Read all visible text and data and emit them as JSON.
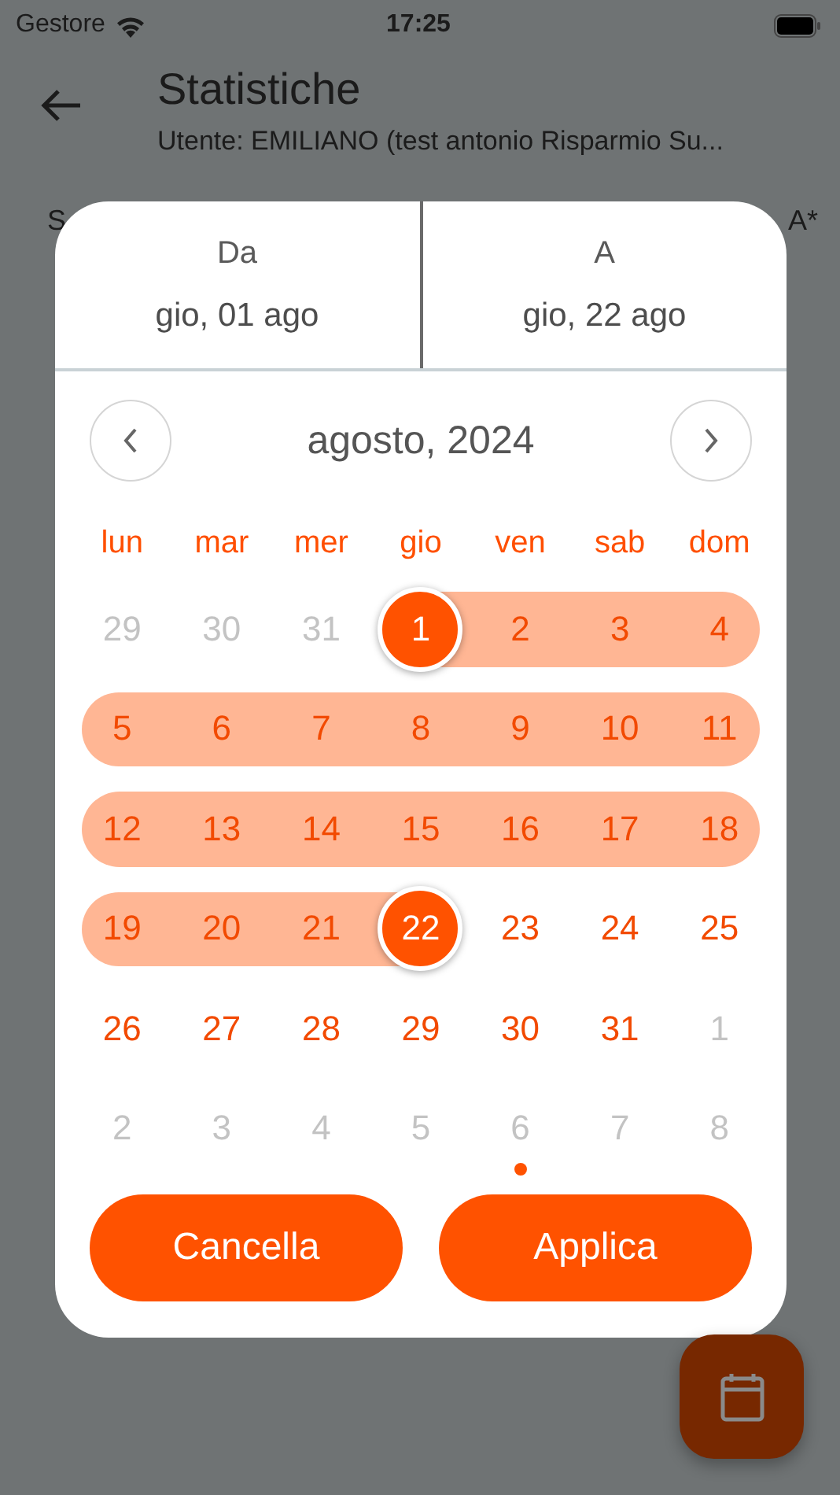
{
  "status_bar": {
    "carrier": "Gestore",
    "time": "17:25"
  },
  "header": {
    "title": "Statistiche",
    "subtitle": "Utente: EMILIANO (test antonio Risparmio Su..."
  },
  "background_row": {
    "left_text": "S",
    "right_text": "A*"
  },
  "date_picker": {
    "range": [
      {
        "label": "Da",
        "value": "gio, 01 ago"
      },
      {
        "label": "A",
        "value": "gio, 22 ago"
      }
    ],
    "month": "agosto, 2024",
    "weekdays": [
      "lun",
      "mar",
      "mer",
      "gio",
      "ven",
      "sab",
      "dom"
    ],
    "days": [
      {
        "label": "29",
        "outside": true,
        "in_range": false,
        "selected": false,
        "marked": false
      },
      {
        "label": "30",
        "outside": true,
        "in_range": false,
        "selected": false,
        "marked": false
      },
      {
        "label": "31",
        "outside": true,
        "in_range": false,
        "selected": false,
        "marked": false
      },
      {
        "label": "1",
        "outside": false,
        "in_range": true,
        "selected": true,
        "marked": false
      },
      {
        "label": "2",
        "outside": false,
        "in_range": true,
        "selected": false,
        "marked": false
      },
      {
        "label": "3",
        "outside": false,
        "in_range": true,
        "selected": false,
        "marked": false
      },
      {
        "label": "4",
        "outside": false,
        "in_range": true,
        "selected": false,
        "marked": false
      },
      {
        "label": "5",
        "outside": false,
        "in_range": true,
        "selected": false,
        "marked": false
      },
      {
        "label": "6",
        "outside": false,
        "in_range": true,
        "selected": false,
        "marked": false
      },
      {
        "label": "7",
        "outside": false,
        "in_range": true,
        "selected": false,
        "marked": false
      },
      {
        "label": "8",
        "outside": false,
        "in_range": true,
        "selected": false,
        "marked": false
      },
      {
        "label": "9",
        "outside": false,
        "in_range": true,
        "selected": false,
        "marked": false
      },
      {
        "label": "10",
        "outside": false,
        "in_range": true,
        "selected": false,
        "marked": false
      },
      {
        "label": "11",
        "outside": false,
        "in_range": true,
        "selected": false,
        "marked": false
      },
      {
        "label": "12",
        "outside": false,
        "in_range": true,
        "selected": false,
        "marked": false
      },
      {
        "label": "13",
        "outside": false,
        "in_range": true,
        "selected": false,
        "marked": false
      },
      {
        "label": "14",
        "outside": false,
        "in_range": true,
        "selected": false,
        "marked": false
      },
      {
        "label": "15",
        "outside": false,
        "in_range": true,
        "selected": false,
        "marked": false
      },
      {
        "label": "16",
        "outside": false,
        "in_range": true,
        "selected": false,
        "marked": false
      },
      {
        "label": "17",
        "outside": false,
        "in_range": true,
        "selected": false,
        "marked": false
      },
      {
        "label": "18",
        "outside": false,
        "in_range": true,
        "selected": false,
        "marked": false
      },
      {
        "label": "19",
        "outside": false,
        "in_range": true,
        "selected": false,
        "marked": false
      },
      {
        "label": "20",
        "outside": false,
        "in_range": true,
        "selected": false,
        "marked": false
      },
      {
        "label": "21",
        "outside": false,
        "in_range": true,
        "selected": false,
        "marked": false
      },
      {
        "label": "22",
        "outside": false,
        "in_range": true,
        "selected": true,
        "marked": false
      },
      {
        "label": "23",
        "outside": false,
        "in_range": false,
        "selected": false,
        "marked": false
      },
      {
        "label": "24",
        "outside": false,
        "in_range": false,
        "selected": false,
        "marked": false
      },
      {
        "label": "25",
        "outside": false,
        "in_range": false,
        "selected": false,
        "marked": false
      },
      {
        "label": "26",
        "outside": false,
        "in_range": false,
        "selected": false,
        "marked": false
      },
      {
        "label": "27",
        "outside": false,
        "in_range": false,
        "selected": false,
        "marked": false
      },
      {
        "label": "28",
        "outside": false,
        "in_range": false,
        "selected": false,
        "marked": false
      },
      {
        "label": "29",
        "outside": false,
        "in_range": false,
        "selected": false,
        "marked": false
      },
      {
        "label": "30",
        "outside": false,
        "in_range": false,
        "selected": false,
        "marked": false
      },
      {
        "label": "31",
        "outside": false,
        "in_range": false,
        "selected": false,
        "marked": false
      },
      {
        "label": "1",
        "outside": true,
        "in_range": false,
        "selected": false,
        "marked": false
      },
      {
        "label": "2",
        "outside": true,
        "in_range": false,
        "selected": false,
        "marked": false
      },
      {
        "label": "3",
        "outside": true,
        "in_range": false,
        "selected": false,
        "marked": false
      },
      {
        "label": "4",
        "outside": true,
        "in_range": false,
        "selected": false,
        "marked": false
      },
      {
        "label": "5",
        "outside": true,
        "in_range": false,
        "selected": false,
        "marked": false
      },
      {
        "label": "6",
        "outside": true,
        "in_range": false,
        "selected": false,
        "marked": true
      },
      {
        "label": "7",
        "outside": true,
        "in_range": false,
        "selected": false,
        "marked": false
      },
      {
        "label": "8",
        "outside": true,
        "in_range": false,
        "selected": false,
        "marked": false
      }
    ],
    "buttons": [
      "Cancella",
      "Applica"
    ]
  }
}
